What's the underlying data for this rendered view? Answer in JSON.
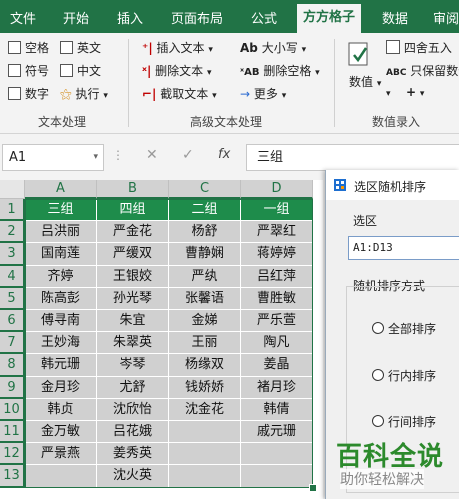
{
  "tabs": [
    "文件",
    "开始",
    "插入",
    "页面布局",
    "公式",
    "方方格子",
    "数据",
    "审阅"
  ],
  "ribbon": {
    "text_group": {
      "checkboxes": [
        "空格",
        "英文",
        "符号",
        "中文",
        "数字"
      ],
      "execute": "执行",
      "label": "文本处理"
    },
    "advanced_group": {
      "insert": "插入文本",
      "delete": "删除文本",
      "extract": "截取文本",
      "case": "大小写",
      "delete_space": "删除空格",
      "more": "更多",
      "label": "高级文本处理"
    },
    "number_group": {
      "value": "数值",
      "round": "四舍五入",
      "keep_values": "只保留数值",
      "label": "数值录入"
    }
  },
  "formula_bar": {
    "name_box": "A1",
    "fx": "fx",
    "value": "三组"
  },
  "columns": [
    "A",
    "B",
    "C",
    "D"
  ],
  "rows": [
    "1",
    "2",
    "3",
    "4",
    "5",
    "6",
    "7",
    "8",
    "9",
    "10",
    "11",
    "12",
    "13"
  ],
  "table": [
    [
      "三组",
      "四组",
      "二组",
      "一组"
    ],
    [
      "吕洪丽",
      "严金花",
      "杨舒",
      "严翠红"
    ],
    [
      "国南莲",
      "严缓双",
      "曹静娴",
      "蒋婷婷"
    ],
    [
      "齐婷",
      "王银姣",
      "严纨",
      "吕红萍"
    ],
    [
      "陈高彭",
      "孙光琴",
      "张馨语",
      "曹胜敏"
    ],
    [
      "傅寻南",
      "朱宜",
      "金娣",
      "严乐萱"
    ],
    [
      "王妙海",
      "朱翠英",
      "王丽",
      "陶凡"
    ],
    [
      "韩元珊",
      "岑琴",
      "杨缘双",
      "姜晶"
    ],
    [
      "金月珍",
      "尤舒",
      "钱娇娇",
      "褚月珍"
    ],
    [
      "韩贞",
      "沈欣怡",
      "沈金花",
      "韩倩"
    ],
    [
      "金万敏",
      "吕花娥",
      "",
      "戚元珊"
    ],
    [
      "严景燕",
      "姜秀英",
      "",
      ""
    ],
    [
      "",
      "沈火英",
      "",
      ""
    ]
  ],
  "dialog": {
    "title": "选区随机排序",
    "selection_label": "选区",
    "selection_value": "A1:D13",
    "method_label": "随机排序方式",
    "options": [
      "全部排序",
      "行内排序",
      "行间排序"
    ]
  },
  "watermark": {
    "title": "百科全说",
    "subtitle": "助你轻松解决"
  },
  "colors": {
    "accent": "#217346",
    "header_fill": "#1e8c4b",
    "selection_fill": "#d0d0d0"
  }
}
